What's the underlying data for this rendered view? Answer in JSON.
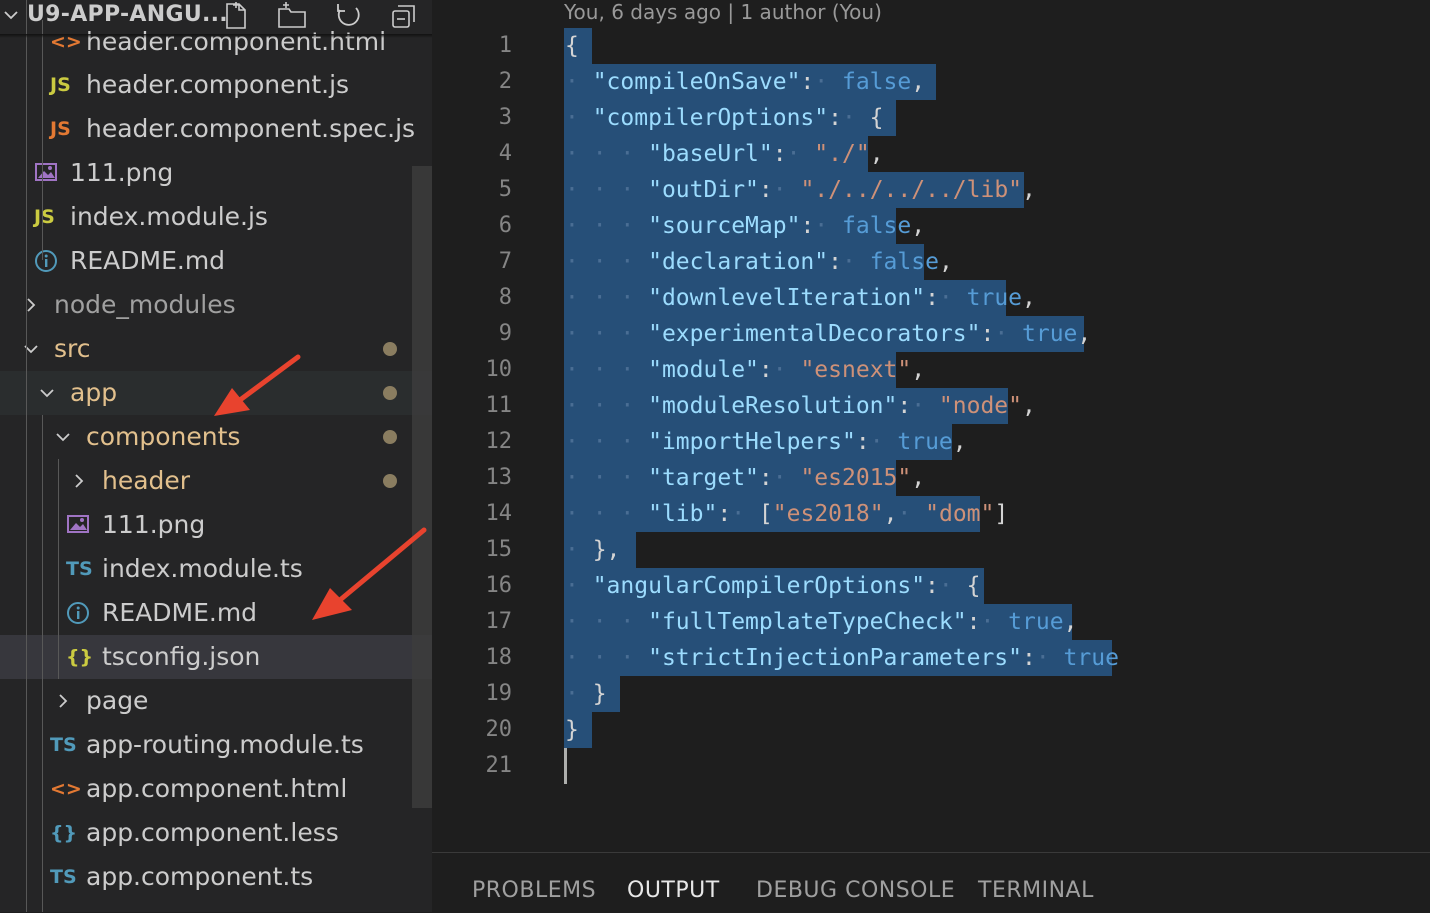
{
  "explorer": {
    "title": "U9-APP-ANGU...",
    "icons": [
      "new-file-icon",
      "new-folder-icon",
      "refresh-icon",
      "collapse-all-icon"
    ],
    "rows": [
      {
        "label": "header.component.html",
        "icon": "html-file-icon",
        "glyph": "<>",
        "color": "#e37933",
        "label_color": "#cccccc"
      },
      {
        "label": "header.component.js",
        "icon": "js-file-icon",
        "glyph": "JS",
        "color": "#cbcb41",
        "label_color": "#cccccc"
      },
      {
        "label": "header.component.spec.js",
        "icon": "js-file-icon",
        "glyph": "JS",
        "color": "#e37933",
        "label_color": "#cccccc"
      },
      {
        "label": "111.png",
        "icon": "image-file-icon",
        "glyph": "",
        "color": "#a074c4",
        "label_color": "#cccccc"
      },
      {
        "label": "index.module.js",
        "icon": "js-file-icon",
        "glyph": "JS",
        "color": "#cbcb41",
        "label_color": "#cccccc"
      },
      {
        "label": "README.md",
        "icon": "info-icon",
        "glyph": "",
        "color": "#519aba",
        "label_color": "#cccccc"
      },
      {
        "label": "node_modules",
        "icon": "chevron-right-icon",
        "glyph": "",
        "color": "#cccccc",
        "label_color": "#a0a0a0"
      },
      {
        "label": "src",
        "icon": "chevron-down-icon",
        "glyph": "",
        "color": "#cccccc",
        "label_color": "#e2c08d"
      },
      {
        "label": "app",
        "icon": "chevron-down-icon",
        "glyph": "",
        "color": "#cccccc",
        "label_color": "#e2c08d"
      },
      {
        "label": "components",
        "icon": "chevron-down-icon",
        "glyph": "",
        "color": "#cccccc",
        "label_color": "#e2c08d"
      },
      {
        "label": "header",
        "icon": "chevron-right-icon",
        "glyph": "",
        "color": "#cccccc",
        "label_color": "#e2c08d"
      },
      {
        "label": "111.png",
        "icon": "image-file-icon",
        "glyph": "",
        "color": "#a074c4",
        "label_color": "#cccccc"
      },
      {
        "label": "index.module.ts",
        "icon": "ts-file-icon",
        "glyph": "TS",
        "color": "#519aba",
        "label_color": "#cccccc"
      },
      {
        "label": "README.md",
        "icon": "info-icon",
        "glyph": "",
        "color": "#519aba",
        "label_color": "#cccccc"
      },
      {
        "label": "tsconfig.json",
        "icon": "json-file-icon",
        "glyph": "{}",
        "color": "#cbcb41",
        "label_color": "#cccccc"
      },
      {
        "label": "page",
        "icon": "chevron-right-icon",
        "glyph": "",
        "color": "#cccccc",
        "label_color": "#cccccc"
      },
      {
        "label": "app-routing.module.ts",
        "icon": "ts-file-icon",
        "glyph": "TS",
        "color": "#519aba",
        "label_color": "#cccccc"
      },
      {
        "label": "app.component.html",
        "icon": "html-file-icon",
        "glyph": "<>",
        "color": "#e37933",
        "label_color": "#cccccc"
      },
      {
        "label": "app.component.less",
        "icon": "less-file-icon",
        "glyph": "{}",
        "color": "#519aba",
        "label_color": "#cccccc"
      },
      {
        "label": "app.component.ts",
        "icon": "ts-file-icon",
        "glyph": "TS",
        "color": "#519aba",
        "label_color": "#cccccc"
      }
    ]
  },
  "editor": {
    "blame": "You, 6 days ago | 1 author (You)",
    "line_numbers": [
      "1",
      "2",
      "3",
      "4",
      "5",
      "6",
      "7",
      "8",
      "9",
      "10",
      "11",
      "12",
      "13",
      "14",
      "15",
      "16",
      "17",
      "18",
      "19",
      "20",
      "21"
    ],
    "lines": [
      [
        [
          "p",
          "{"
        ]
      ],
      [
        [
          "ws",
          "·"
        ],
        [
          "k",
          "\"compileOnSave\""
        ],
        [
          "p",
          ":"
        ],
        [
          "ws",
          "·"
        ],
        [
          "b",
          "false"
        ],
        [
          "p",
          ","
        ]
      ],
      [
        [
          "ws",
          "·"
        ],
        [
          "k",
          "\"compilerOptions\""
        ],
        [
          "p",
          ":"
        ],
        [
          "ws",
          "·"
        ],
        [
          "p",
          "{"
        ]
      ],
      [
        [
          "ws",
          "·"
        ],
        [
          "ws",
          "·"
        ],
        [
          "ws",
          "·"
        ],
        [
          "k",
          "\"baseUrl\""
        ],
        [
          "p",
          ":"
        ],
        [
          "ws",
          "·"
        ],
        [
          "s",
          "\"./\""
        ],
        [
          "p",
          ","
        ]
      ],
      [
        [
          "ws",
          "·"
        ],
        [
          "ws",
          "·"
        ],
        [
          "ws",
          "·"
        ],
        [
          "k",
          "\"outDir\""
        ],
        [
          "p",
          ":"
        ],
        [
          "ws",
          "·"
        ],
        [
          "s",
          "\"./../../../lib\""
        ],
        [
          "p",
          ","
        ]
      ],
      [
        [
          "ws",
          "·"
        ],
        [
          "ws",
          "·"
        ],
        [
          "ws",
          "·"
        ],
        [
          "k",
          "\"sourceMap\""
        ],
        [
          "p",
          ":"
        ],
        [
          "ws",
          "·"
        ],
        [
          "b",
          "false"
        ],
        [
          "p",
          ","
        ]
      ],
      [
        [
          "ws",
          "·"
        ],
        [
          "ws",
          "·"
        ],
        [
          "ws",
          "·"
        ],
        [
          "k",
          "\"declaration\""
        ],
        [
          "p",
          ":"
        ],
        [
          "ws",
          "·"
        ],
        [
          "b",
          "false"
        ],
        [
          "p",
          ","
        ]
      ],
      [
        [
          "ws",
          "·"
        ],
        [
          "ws",
          "·"
        ],
        [
          "ws",
          "·"
        ],
        [
          "k",
          "\"downlevelIteration\""
        ],
        [
          "p",
          ":"
        ],
        [
          "ws",
          "·"
        ],
        [
          "b",
          "true"
        ],
        [
          "p",
          ","
        ]
      ],
      [
        [
          "ws",
          "·"
        ],
        [
          "ws",
          "·"
        ],
        [
          "ws",
          "·"
        ],
        [
          "k",
          "\"experimentalDecorators\""
        ],
        [
          "p",
          ":"
        ],
        [
          "ws",
          "·"
        ],
        [
          "b",
          "true"
        ],
        [
          "p",
          ","
        ]
      ],
      [
        [
          "ws",
          "·"
        ],
        [
          "ws",
          "·"
        ],
        [
          "ws",
          "·"
        ],
        [
          "k",
          "\"module\""
        ],
        [
          "p",
          ":"
        ],
        [
          "ws",
          "·"
        ],
        [
          "s",
          "\"esnext\""
        ],
        [
          "p",
          ","
        ]
      ],
      [
        [
          "ws",
          "·"
        ],
        [
          "ws",
          "·"
        ],
        [
          "ws",
          "·"
        ],
        [
          "k",
          "\"moduleResolution\""
        ],
        [
          "p",
          ":"
        ],
        [
          "ws",
          "·"
        ],
        [
          "s",
          "\"node\""
        ],
        [
          "p",
          ","
        ]
      ],
      [
        [
          "ws",
          "·"
        ],
        [
          "ws",
          "·"
        ],
        [
          "ws",
          "·"
        ],
        [
          "k",
          "\"importHelpers\""
        ],
        [
          "p",
          ":"
        ],
        [
          "ws",
          "·"
        ],
        [
          "b",
          "true"
        ],
        [
          "p",
          ","
        ]
      ],
      [
        [
          "ws",
          "·"
        ],
        [
          "ws",
          "·"
        ],
        [
          "ws",
          "·"
        ],
        [
          "k",
          "\"target\""
        ],
        [
          "p",
          ":"
        ],
        [
          "ws",
          "·"
        ],
        [
          "s",
          "\"es2015\""
        ],
        [
          "p",
          ","
        ]
      ],
      [
        [
          "ws",
          "·"
        ],
        [
          "ws",
          "·"
        ],
        [
          "ws",
          "·"
        ],
        [
          "k",
          "\"lib\""
        ],
        [
          "p",
          ":"
        ],
        [
          "ws",
          "·"
        ],
        [
          "p",
          "["
        ],
        [
          "s",
          "\"es2018\""
        ],
        [
          "p",
          ","
        ],
        [
          "ws",
          "·"
        ],
        [
          "s",
          "\"dom\""
        ],
        [
          "p",
          "]"
        ]
      ],
      [
        [
          "ws",
          "·"
        ],
        [
          "p",
          "},"
        ]
      ],
      [
        [
          "ws",
          "·"
        ],
        [
          "k",
          "\"angularCompilerOptions\""
        ],
        [
          "p",
          ":"
        ],
        [
          "ws",
          "·"
        ],
        [
          "p",
          "{"
        ]
      ],
      [
        [
          "ws",
          "·"
        ],
        [
          "ws",
          "·"
        ],
        [
          "ws",
          "·"
        ],
        [
          "k",
          "\"fullTemplateTypeCheck\""
        ],
        [
          "p",
          ":"
        ],
        [
          "ws",
          "·"
        ],
        [
          "b",
          "true"
        ],
        [
          "p",
          ","
        ]
      ],
      [
        [
          "ws",
          "·"
        ],
        [
          "ws",
          "·"
        ],
        [
          "ws",
          "·"
        ],
        [
          "k",
          "\"strictInjectionParameters\""
        ],
        [
          "p",
          ":"
        ],
        [
          "ws",
          "·"
        ],
        [
          "b",
          "true"
        ]
      ],
      [
        [
          "ws",
          "·"
        ],
        [
          "p",
          "}"
        ]
      ],
      [
        [
          "p",
          "}"
        ]
      ],
      []
    ]
  },
  "panel": {
    "tabs": [
      "PROBLEMS",
      "OUTPUT",
      "DEBUG CONSOLE",
      "TERMINAL"
    ],
    "active": "OUTPUT"
  },
  "colors": {
    "accent_arrow": "#e8432e",
    "selection": "#264f78"
  }
}
